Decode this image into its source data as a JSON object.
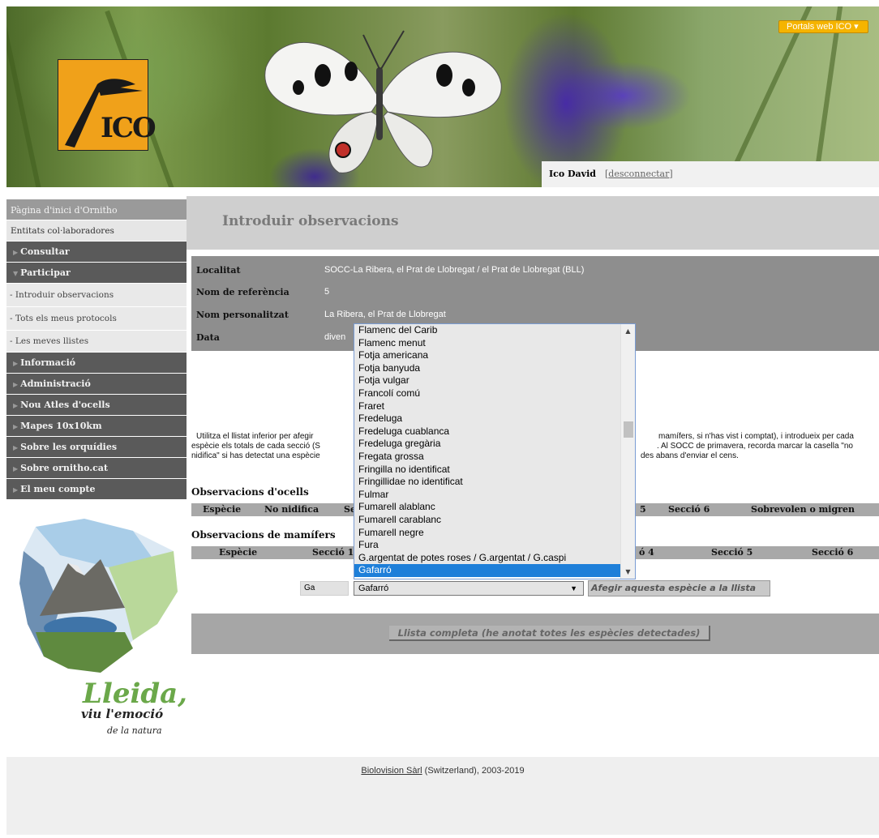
{
  "header": {
    "logo_text": "ICO",
    "portals_button": "Portals web ICO ▾",
    "user_name": "Ico David",
    "logout_link": "desconnectar"
  },
  "sidebar": {
    "home": "Pàgina d'inici d'Ornitho",
    "partners": "Entitats col·laboradores",
    "consultar": "Consultar",
    "participar": "Participar",
    "sub_introduir": "- Introduir observacions",
    "sub_protocols": "- Tots els meus protocols",
    "sub_llistes": "- Les meves llistes",
    "informacio": "Informació",
    "administracio": "Administració",
    "atles": "Nou Atles d'ocells",
    "mapes": "Mapes 10x10km",
    "orquidies": "Sobre les orquídies",
    "ornitho": "Sobre ornitho.cat",
    "compte": "El meu compte"
  },
  "ad": {
    "title": "Lleida,",
    "line1": "viu l'emoció",
    "line2": "de la natura"
  },
  "main": {
    "page_title": "Introduir observacions",
    "form": {
      "localitat_label": "Localitat",
      "localitat_value": "SOCC-La Ribera, el Prat de Llobregat / el Prat de Llobregat (BLL)",
      "ref_label": "Nom de referència",
      "ref_value": "5",
      "custom_label": "Nom personalitzat",
      "custom_value": "La Ribera, el Prat de Llobregat",
      "data_label": "Data",
      "data_value": "diven"
    },
    "instructions": {
      "line1_left": "Utilitza el llistat inferior per afegir",
      "line1_right": "mamífers, si n'has vist i comptat), i introdueix per cada",
      "line2_left": "espècie els totals de cada secció (S",
      "line2_right": ". Al SOCC de primavera, recorda marcar la casella \"no",
      "line3_left": "nidifica\" si has detectat una espècie",
      "line3_right": "des abans d'enviar el cens."
    },
    "birds_title": "Observacions d'ocells",
    "birds_headers": {
      "especie": "Espècie",
      "no_nidifica": "No nidifica",
      "seccio_partial": "Se",
      "seccio5": "5",
      "seccio6": "Secció 6",
      "sobrevolen": "Sobrevolen o migren"
    },
    "mammals_title": "Observacions de mamífers",
    "mammals_headers": {
      "especie": "Espècie",
      "seccio1": "Secció 1",
      "seccio4": "ó 4",
      "seccio5": "Secció 5",
      "seccio6": "Secció 6"
    },
    "quick_input_value": "Ga",
    "species_selected": "Gafarró",
    "add_species_button": "Afegir aquesta espècie a la llista",
    "complete_button": "Llista completa (he anotat totes les espècies detectades)"
  },
  "dropdown": {
    "items": [
      "Flamenc del Carib",
      "Flamenc menut",
      "Fotja americana",
      "Fotja banyuda",
      "Fotja vulgar",
      "Francolí comú",
      "Fraret",
      "Fredeluga",
      "Fredeluga cuablanca",
      "Fredeluga gregària",
      "Fregata grossa",
      "Fringilla no identificat",
      "Fringillidae no identificat",
      "Fulmar",
      "Fumarell alablanc",
      "Fumarell carablanc",
      "Fumarell negre",
      "Fura",
      "G.argentat de potes roses / G.argentat / G.caspi",
      "Gafarró"
    ],
    "selected_index": 19
  },
  "footer": {
    "company_link": "Biolovision Sàrl",
    "rest": " (Switzerland), 2003-2019"
  },
  "colors": {
    "accent_orange": "#f5b400",
    "selection_blue": "#1e7fd9",
    "nav_dark": "#5a5a5a"
  }
}
